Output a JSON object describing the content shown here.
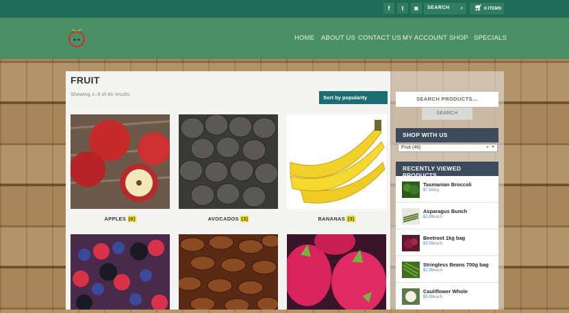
{
  "topbar": {
    "social": [
      {
        "name": "facebook-icon",
        "glyph": "f"
      },
      {
        "name": "twitter-icon",
        "glyph": "t"
      },
      {
        "name": "instagram-icon",
        "glyph": "◙"
      }
    ],
    "search_label": "SEARCH",
    "cart_label": "0 ITEMS"
  },
  "nav": {
    "items": [
      "HOME",
      "ABOUT US",
      "CONTACT US",
      "MY ACCOUNT",
      "SHOP",
      "SPECIALS"
    ]
  },
  "main": {
    "title": "FRUIT",
    "results": "Showing 1–9 of 46 results",
    "sort_label": "Sort by popularity",
    "products": [
      {
        "name": "APPLES",
        "count": "(6)"
      },
      {
        "name": "AVOCADOS",
        "count": "(3)"
      },
      {
        "name": "BANANAS",
        "count": "(3)"
      },
      {
        "name": "",
        "count": ""
      },
      {
        "name": "",
        "count": ""
      },
      {
        "name": "",
        "count": ""
      }
    ]
  },
  "sidebar": {
    "search_placeholder": "SEARCH PRODUCTS…",
    "search_button": "SEARCH",
    "shop_with_us": "SHOP WITH US",
    "category_value": "Fruit  (46)",
    "recent_heading": "RECENTLY VIEWED PRODUCTS",
    "recent": [
      {
        "name": "Tasmanian Broccoli",
        "price": "$7.50",
        "unit": "/kg"
      },
      {
        "name": "Asparagus Bunch",
        "price": "$2.99",
        "unit": "each"
      },
      {
        "name": "Beetroot 1kg bag",
        "price": "$3.99",
        "unit": "each"
      },
      {
        "name": "Stringless Beans 700g bag",
        "price": "$2.99",
        "unit": "each"
      },
      {
        "name": "Cauliflower Whole",
        "price": "$5.99",
        "unit": "each"
      }
    ]
  },
  "colors": {
    "topbar": "#1f6b53",
    "header": "#4a8f66",
    "sort_button": "#1a6d70",
    "widget_header": "#3c4a5c",
    "price": "#3a87c8",
    "count_highlight": "#f5e400"
  }
}
